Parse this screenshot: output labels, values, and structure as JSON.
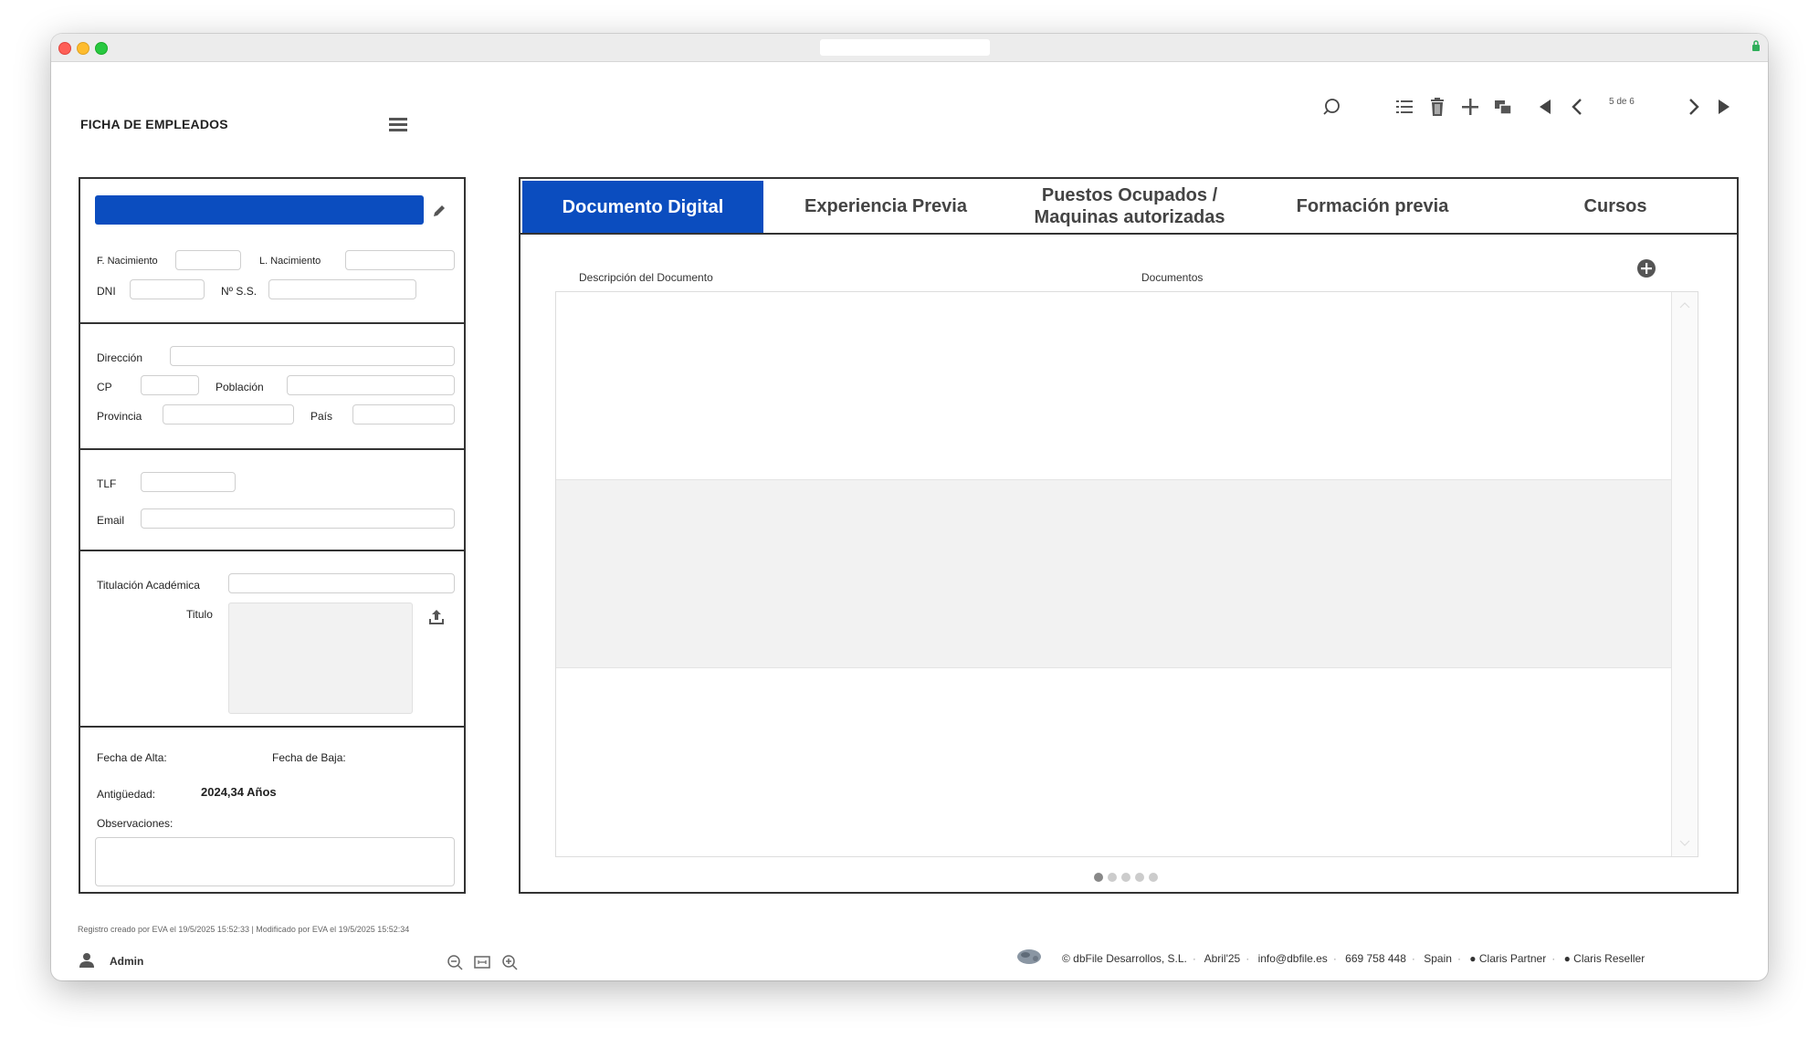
{
  "app": {
    "title": "FICHA DE EMPLEADOS",
    "record_counter": "5 de 6"
  },
  "employee": {
    "labels": {
      "f_nacimiento": "F. Nacimiento",
      "l_nacimiento": "L. Nacimiento",
      "dni": "DNI",
      "nss": "Nº S.S.",
      "direccion": "Dirección",
      "cp": "CP",
      "poblacion": "Población",
      "provincia": "Provincia",
      "pais": "País",
      "tlf": "TLF",
      "email": "Email",
      "titulacion": "Titulación Académica",
      "titulo": "Titulo",
      "fecha_alta": "Fecha de Alta:",
      "fecha_baja": "Fecha de Baja:",
      "antiguedad": "Antigüedad:",
      "observaciones": "Observaciones:"
    },
    "values": {
      "name": "",
      "f_nacimiento": "",
      "l_nacimiento": "",
      "dni": "",
      "nss": "",
      "direccion": "",
      "cp": "",
      "poblacion": "",
      "provincia": "",
      "pais": "",
      "tlf": "",
      "email": "",
      "titulacion": "",
      "antiguedad": "2024,34 Años",
      "observaciones": ""
    }
  },
  "tabs": [
    {
      "label": "Documento Digital",
      "active": true
    },
    {
      "label": "Experiencia Previa",
      "active": false
    },
    {
      "label": "Puestos Ocupados  /\nMaquinas autorizadas",
      "active": false
    },
    {
      "label": "Formación previa",
      "active": false
    },
    {
      "label": "Cursos",
      "active": false
    }
  ],
  "documents": {
    "columns": [
      "Descripción del Documento",
      "Documentos"
    ],
    "rows": [],
    "page_dots": 5,
    "active_dot": 0
  },
  "footer": {
    "record_meta": "Registro creado por EVA el 19/5/2025 15:52:33  |  Modificado por EVA el 19/5/2025 15:52:34",
    "user": "Admin",
    "credits": [
      "© dbFile Desarrollos, S.L.",
      "Abril'25",
      "info@dbfile.es",
      "669 758 448",
      "Spain",
      "Claris Partner",
      "Claris Reseller"
    ]
  },
  "colors": {
    "accent": "#0b4dbf",
    "border": "#333333",
    "row_alt": "#f2f2f2"
  },
  "icons": [
    "search-icon",
    "list-icon",
    "trash-icon",
    "plus-icon",
    "duplicate-icon",
    "first-record-icon",
    "prev-record-icon",
    "next-record-icon",
    "last-record-icon",
    "pencil-icon",
    "upload-icon",
    "add-circle-icon",
    "user-icon",
    "zoom-out-icon",
    "fit-icon",
    "zoom-in-icon",
    "apple-icon"
  ]
}
